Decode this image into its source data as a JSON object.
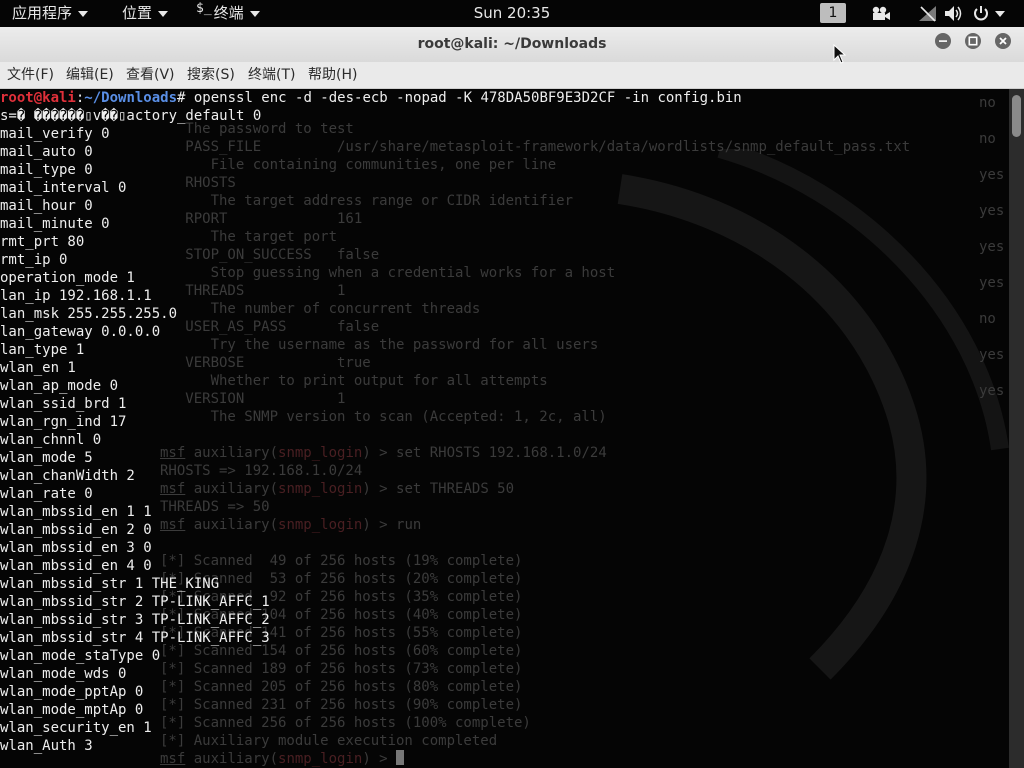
{
  "top_panel": {
    "applications": "应用程序",
    "places": "位置",
    "terminal_glyph": "$_",
    "terminal_app": "终端",
    "clock": "Sun 20:35",
    "workspace": "1",
    "icons": [
      "applications-caret-icon",
      "places-caret-icon",
      "terminal-caret-icon",
      "video-camera-icon",
      "network-disabled-icon",
      "volume-icon",
      "power-icon",
      "power-caret-icon"
    ]
  },
  "window": {
    "title": "root@kali: ~/Downloads",
    "icons": [
      "minimize-icon",
      "maximize-icon",
      "close-icon"
    ]
  },
  "menubar": [
    "文件(F)",
    "编辑(E)",
    "查看(V)",
    "搜索(S)",
    "终端(T)",
    "帮助(H)"
  ],
  "terminal": {
    "prompt_user": "root@kali",
    "prompt_sep": ":",
    "prompt_path": "~/Downloads",
    "command": "# openssl enc -d -des-ecb -nopad -K 478DA50BF9E3D2CF -in config.bin",
    "fg_lines": [
      "s=� ������▯v��▯actory_default 0",
      "mail_verify 0",
      "mail_auto 0",
      "mail_type 0",
      "mail_interval 0",
      "mail_hour 0",
      "mail_minute 0",
      "rmt_prt 80",
      "rmt_ip 0",
      "operation_mode 1",
      "lan_ip 192.168.1.1",
      "lan_msk 255.255.255.0",
      "lan_gateway 0.0.0.0",
      "lan_type 1",
      "wlan_en 1",
      "wlan_ap_mode 0",
      "wlan_ssid_brd 1",
      "wlan_rgn_ind 17",
      "wlan_chnnl 0",
      "wlan_mode 5",
      "wlan_chanWidth 2",
      "wlan_rate 0",
      "wlan_mbssid_en 1 1",
      "wlan_mbssid_en 2 0",
      "wlan_mbssid_en 3 0",
      "wlan_mbssid_en 4 0",
      "wlan_mbssid_str 1 THE_KING",
      "wlan_mbssid_str 2 TP-LINK_AFFC_1",
      "wlan_mbssid_str 3 TP-LINK_AFFC_2",
      "wlan_mbssid_str 4 TP-LINK_AFFC_3",
      "wlan_mode_staType 0",
      "wlan_mode_wds 0",
      "wlan_mode_pptAp 0",
      "wlan_mode_mptAp 0",
      "wlan_security_en 1",
      "wlan_Auth 3"
    ],
    "bg_lines": [
      "",
      "   The password to test",
      "   PASS_FILE         /usr/share/metasploit-framework/data/wordlists/snmp_default_pass.txt",
      "      File containing communities, one per line",
      "   RHOSTS",
      "      The target address range or CIDR identifier",
      "   RPORT             161",
      "      The target port",
      "   STOP_ON_SUCCESS   false",
      "      Stop guessing when a credential works for a host",
      "   THREADS           1",
      "      The number of concurrent threads",
      "   USER_AS_PASS      false",
      "      Try the username as the password for all users",
      "   VERBOSE           true",
      "      Whether to print output for all attempts",
      "   VERSION           1",
      "      The SNMP version to scan (Accepted: 1, 2c, all)",
      "",
      "msf auxiliary(snmp_login) > set RHOSTS 192.168.1.0/24",
      "RHOSTS => 192.168.1.0/24",
      "msf auxiliary(snmp_login) > set THREADS 50",
      "THREADS => 50",
      "msf auxiliary(snmp_login) > run",
      "",
      "[*] Scanned  49 of 256 hosts (19% complete)",
      "[*] Scanned  53 of 256 hosts (20% complete)",
      "[*] Scanned  92 of 256 hosts (35% complete)",
      "[*] Scanned 104 of 256 hosts (40% complete)",
      "[*] Scanned 141 of 256 hosts (55% complete)",
      "[*] Scanned 154 of 256 hosts (60% complete)",
      "[*] Scanned 189 of 256 hosts (73% complete)",
      "[*] Scanned 205 of 256 hosts (80% complete)",
      "[*] Scanned 231 of 256 hosts (90% complete)",
      "[*] Scanned 256 of 256 hosts (100% complete)",
      "[*] Auxiliary module execution completed",
      "msf auxiliary(snmp_login) > "
    ],
    "bg_right": [
      "no",
      "",
      "no",
      "",
      "yes",
      "",
      "yes",
      "",
      "yes",
      "",
      "yes",
      "",
      "no",
      "",
      "yes",
      "",
      "yes"
    ]
  },
  "colors": {
    "prompt_user": "#e0303a",
    "prompt_path": "#5a8fe6",
    "bg_text": "#3b3b3b",
    "fg_text": "#eeeeee"
  }
}
